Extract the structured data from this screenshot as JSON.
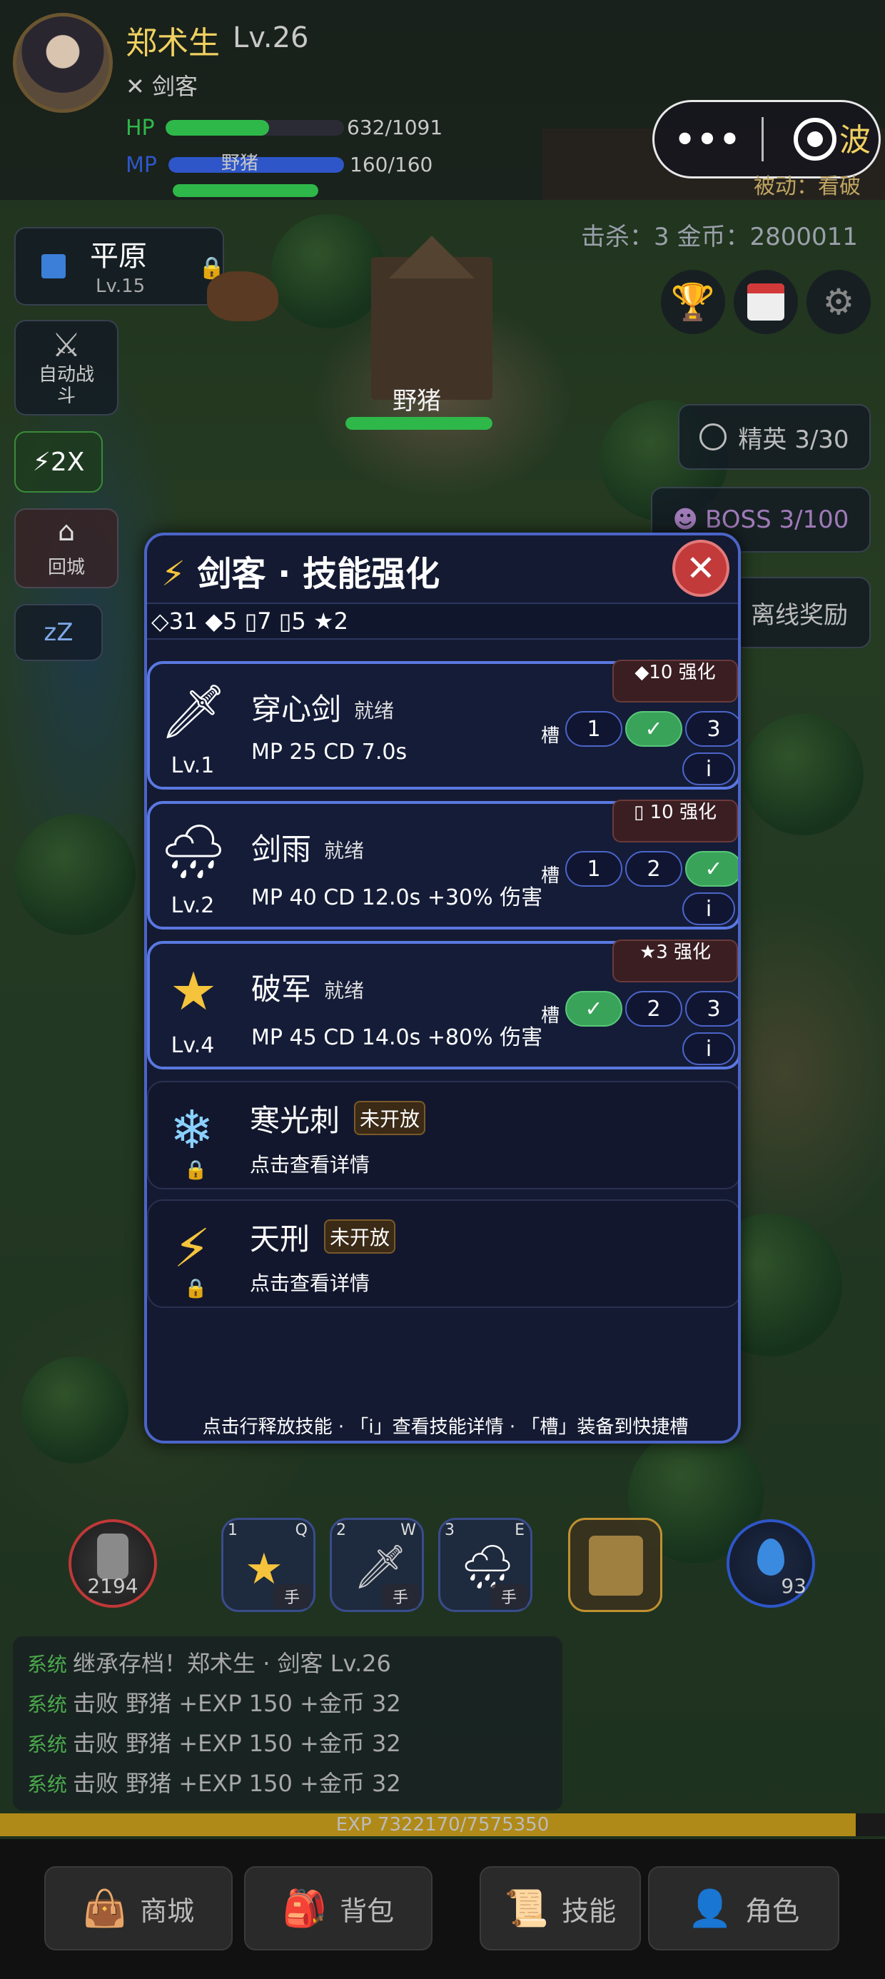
{
  "player": {
    "name": "郑术生",
    "level": "Lv.26",
    "class_icon": "crossed-swords-icon",
    "class_name": "剑客",
    "hp_label": "HP",
    "hp_value": "632/1091",
    "hp_fraction": 0.58,
    "mp_label": "MP",
    "mp_value": "160/160",
    "mp_fraction": 1.0
  },
  "capsule": {
    "more_label": "•••"
  },
  "wave_label": "波",
  "passive_label": "被动：看破",
  "battle_stats": "击杀：3  金币：2800011",
  "map": {
    "zone_name": "平原",
    "zone_level": "Lv.15",
    "enemy_name": "野猪",
    "enemy_name_top": "野猪"
  },
  "left_buttons": {
    "auto_battle": "自动战斗",
    "speed": "⚡2X",
    "return_city": "回城",
    "sleep": "zZ"
  },
  "right_buttons": {
    "elite": "精英 3/30",
    "boss": "BOSS 3/100",
    "offline": "离线奖励"
  },
  "modal": {
    "title": "剑客 · 技能强化",
    "resources": "◇31  ◆5  ▯7  ▯5  ★2",
    "slot_label": "槽",
    "info_label": "i",
    "skills": [
      {
        "name": "穿心剑",
        "status": "就绪",
        "level": "Lv.1",
        "stats": "MP 25   CD 7.0s",
        "enhance": "◆10 强化",
        "slots": [
          "1",
          "✓",
          "3"
        ],
        "active_slot": 1,
        "icon": "dagger-icon"
      },
      {
        "name": "剑雨",
        "status": "就绪",
        "level": "Lv.2",
        "stats": "MP 40   CD 12.0s   +30% 伤害",
        "enhance": "▯ 10 强化",
        "slots": [
          "1",
          "2",
          "✓"
        ],
        "active_slot": 2,
        "icon": "rain-cloud-icon"
      },
      {
        "name": "破军",
        "status": "就绪",
        "level": "Lv.4",
        "stats": "MP 45   CD 14.0s   +80% 伤害",
        "enhance": "★3 强化",
        "slots": [
          "✓",
          "2",
          "3"
        ],
        "active_slot": 0,
        "icon": "shooting-star-icon"
      }
    ],
    "locked_skills": [
      {
        "name": "寒光刺",
        "tag": "未开放",
        "hint": "点击查看详情",
        "icon": "snowflake-icon"
      },
      {
        "name": "天刑",
        "tag": "未开放",
        "hint": "点击查看详情",
        "icon": "lightning-icon"
      }
    ],
    "footer": "点击行释放技能 · 「i」查看技能详情 · 「槽」装备到快捷槽"
  },
  "hotbar": {
    "potion_count": "2194",
    "mana_count": "93",
    "slots": [
      {
        "num": "1",
        "key": "Q",
        "tag": "手"
      },
      {
        "num": "2",
        "key": "W",
        "tag": "手"
      },
      {
        "num": "3",
        "key": "E",
        "tag": "手"
      }
    ]
  },
  "log": {
    "tag": "系统",
    "lines": [
      "继承存档！郑术生 · 剑客 Lv.26",
      "击败 野猪 +EXP 150 +金币 32",
      "击败 野猪 +EXP 150 +金币 32",
      "击败 野猪 +EXP 150 +金币 32"
    ]
  },
  "exp": {
    "text": "EXP 7322170/7575350",
    "fraction": 0.967
  },
  "nav": {
    "shop": "商城",
    "bag": "背包",
    "skills": "技能",
    "character": "角色"
  },
  "colors": {
    "accent_blue": "#4c64c8",
    "active_green": "#3aa35a",
    "gold": "#f0d060",
    "hp_green": "#2fb84a",
    "mp_blue": "#2e56c8"
  }
}
